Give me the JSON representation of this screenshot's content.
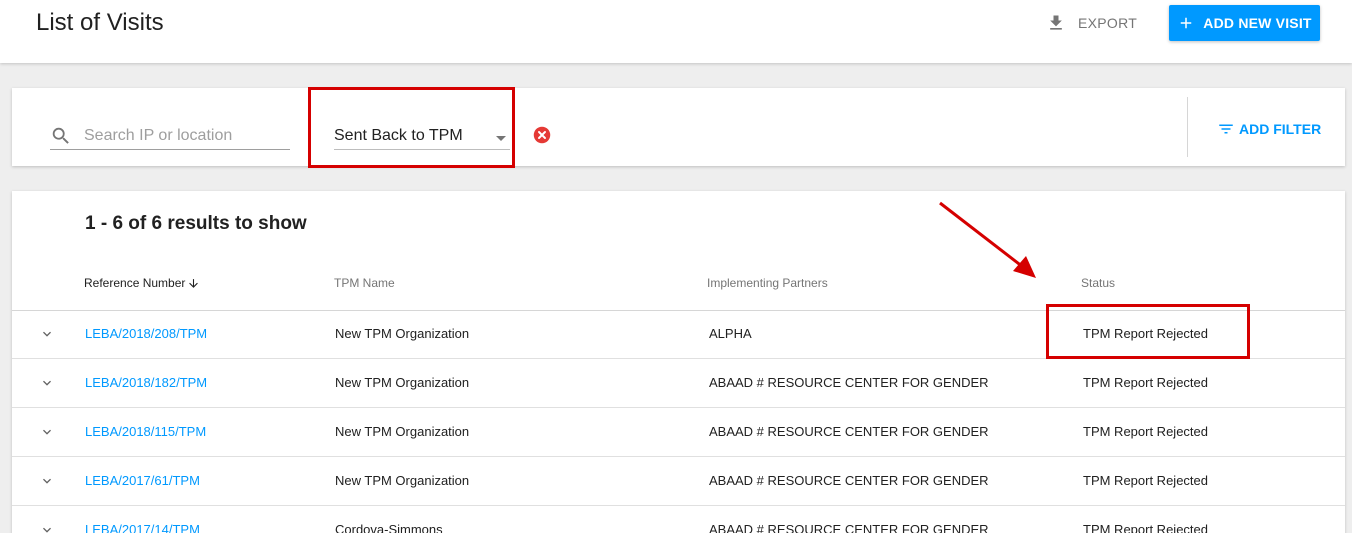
{
  "header": {
    "title": "List of Visits",
    "export_label": "EXPORT",
    "add_new_label": "ADD NEW VISIT"
  },
  "filters": {
    "search_placeholder": "Search IP or location",
    "search_value": "",
    "status_selected": "Sent Back to TPM",
    "add_filter_label": "ADD FILTER"
  },
  "results": {
    "count_text": "1 - 6 of 6 results to show",
    "columns": [
      "Reference Number",
      "TPM Name",
      "Implementing Partners",
      "Status"
    ],
    "sorted_column": "Reference Number",
    "rows": [
      {
        "ref": "LEBA/2018/208/TPM",
        "tpm": "New TPM Organization",
        "partner": "ALPHA",
        "status": "TPM Report Rejected"
      },
      {
        "ref": "LEBA/2018/182/TPM",
        "tpm": "New TPM Organization",
        "partner": "ABAAD # RESOURCE CENTER FOR GENDER",
        "status": "TPM Report Rejected"
      },
      {
        "ref": "LEBA/2018/115/TPM",
        "tpm": "New TPM Organization",
        "partner": "ABAAD # RESOURCE CENTER FOR GENDER",
        "status": "TPM Report Rejected"
      },
      {
        "ref": "LEBA/2017/61/TPM",
        "tpm": "New TPM Organization",
        "partner": "ABAAD # RESOURCE CENTER FOR GENDER",
        "status": "TPM Report Rejected"
      },
      {
        "ref": "LEBA/2017/14/TPM",
        "tpm": "Cordova-Simmons",
        "partner": "ABAAD # RESOURCE CENTER FOR GENDER",
        "status": "TPM Report Rejected"
      }
    ]
  },
  "colors": {
    "accent": "#0099ff",
    "annotation": "#d50000",
    "clear_icon": "#e53935"
  },
  "icons": {
    "export": "download-icon",
    "add": "plus-icon",
    "search": "search-icon",
    "clear": "clear-circle-icon",
    "filter": "filter-list-icon",
    "sort": "arrow-down-icon",
    "expand": "chevron-down-icon"
  }
}
